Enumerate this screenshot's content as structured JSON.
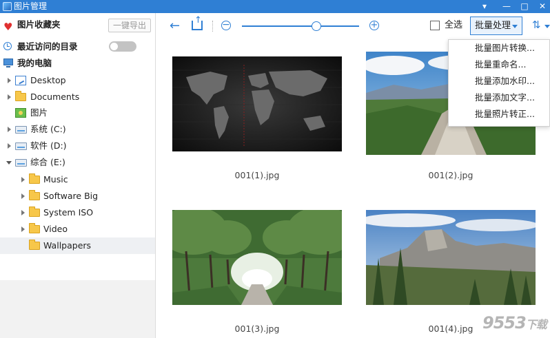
{
  "window": {
    "title": "图片管理",
    "controls": {
      "minimize": "▾",
      "restore": "—",
      "maximize": "□",
      "close": "✕"
    }
  },
  "sidebar": {
    "favorites_label": "图片收藏夹",
    "export_button": "一键导出",
    "recent_label": "最近访问的目录",
    "recent_toggle_on": false,
    "computer_label": "我的电脑",
    "tree": [
      {
        "label": "Desktop",
        "icon": "desktop-icon"
      },
      {
        "label": "Documents",
        "icon": "folder-icon"
      },
      {
        "label": "图片",
        "icon": "picture-icon"
      },
      {
        "label": "系统 (C:)",
        "icon": "drive-icon"
      },
      {
        "label": "软件 (D:)",
        "icon": "drive-icon"
      },
      {
        "label": "综合 (E:)",
        "icon": "drive-icon",
        "expanded": true
      },
      {
        "label": "Music",
        "icon": "folder-icon"
      },
      {
        "label": "Software Big",
        "icon": "folder-icon"
      },
      {
        "label": "System ISO",
        "icon": "folder-icon"
      },
      {
        "label": "Video",
        "icon": "folder-icon"
      },
      {
        "label": "Wallpapers",
        "icon": "folder-icon",
        "selected": true
      }
    ]
  },
  "toolbar": {
    "select_all_label": "全选",
    "select_all_checked": false,
    "batch_label": "批量处理",
    "zoom_level": 0.6
  },
  "batch_menu": {
    "items": [
      "批量图片转换...",
      "批量重命名...",
      "批量添加水印...",
      "批量添加文字...",
      "批量照片转正..."
    ]
  },
  "gallery": {
    "images": [
      {
        "filename": "001(1).jpg",
        "subject": "world map dark"
      },
      {
        "filename": "001(2).jpg",
        "subject": "mountain cliff"
      },
      {
        "filename": "001(3).jpg",
        "subject": "tree tunnel road"
      },
      {
        "filename": "001(4).jpg",
        "subject": "valley granite dome"
      }
    ]
  },
  "watermark": {
    "main": "9553",
    "sub": "下载"
  },
  "colors": {
    "accent": "#2f7fd4",
    "titlebar": "#2f7fd4"
  }
}
